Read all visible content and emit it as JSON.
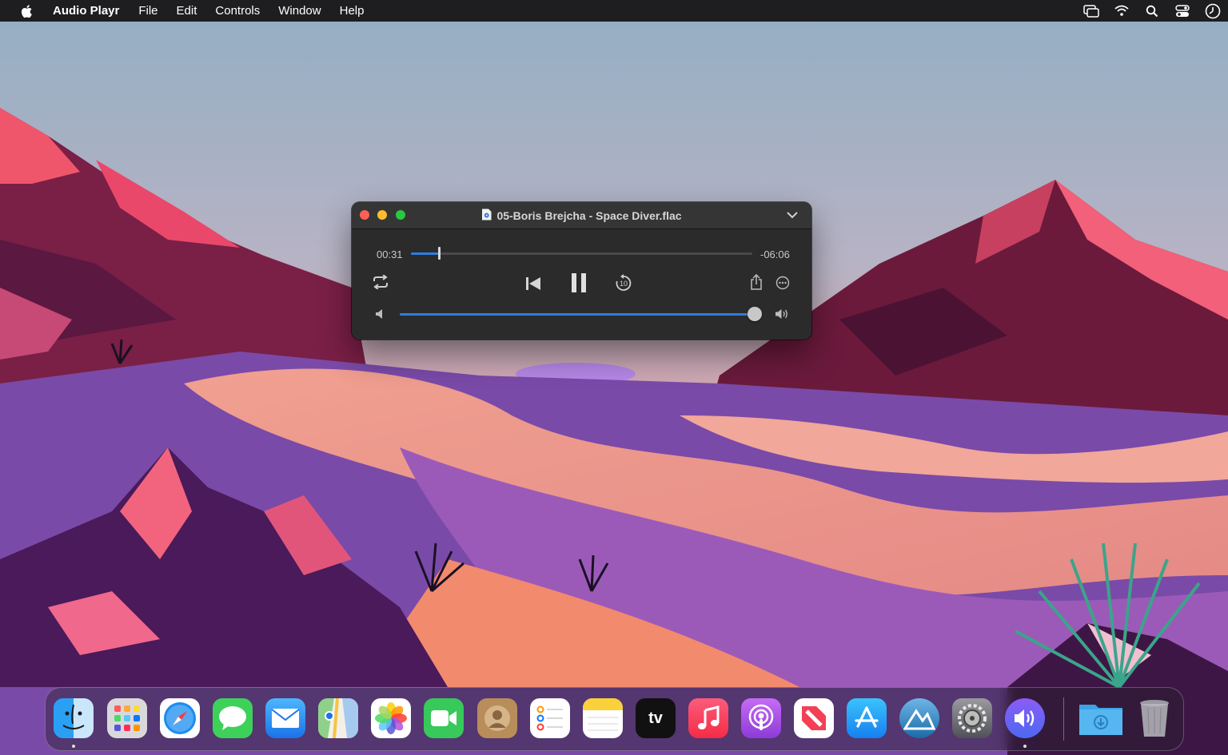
{
  "menubar": {
    "app_name": "Audio Playr",
    "menus": [
      "File",
      "Edit",
      "Controls",
      "Window",
      "Help"
    ],
    "status_icons": [
      "screen-mirroring-icon",
      "wifi-icon",
      "search-icon",
      "control-center-icon",
      "clock-icon"
    ]
  },
  "player": {
    "title": "05-Boris Brejcha - Space Diver.flac",
    "elapsed": "00:31",
    "remaining": "-06:06",
    "progress_fraction": 0.083,
    "volume_fraction": 0.995,
    "controls": [
      "repeat-icon",
      "previous-track-icon",
      "pause-icon",
      "skip-back-10-icon",
      "share-icon",
      "more-icon"
    ],
    "accent_color": "#2f7de1"
  },
  "dock": {
    "apps": [
      {
        "name": "Finder",
        "icon": "finder-icon",
        "running": true
      },
      {
        "name": "Launchpad",
        "icon": "launchpad-icon",
        "running": false
      },
      {
        "name": "Safari",
        "icon": "safari-icon",
        "running": false
      },
      {
        "name": "Messages",
        "icon": "messages-icon",
        "running": false
      },
      {
        "name": "Mail",
        "icon": "mail-icon",
        "running": false
      },
      {
        "name": "Maps",
        "icon": "maps-icon",
        "running": false
      },
      {
        "name": "Photos",
        "icon": "photos-icon",
        "running": false
      },
      {
        "name": "FaceTime",
        "icon": "facetime-icon",
        "running": false
      },
      {
        "name": "Contacts",
        "icon": "contacts-icon",
        "running": false
      },
      {
        "name": "Reminders",
        "icon": "reminders-icon",
        "running": false
      },
      {
        "name": "Notes",
        "icon": "notes-icon",
        "running": false
      },
      {
        "name": "TV",
        "icon": "apple-tv-icon",
        "label": "tv",
        "running": false
      },
      {
        "name": "Music",
        "icon": "music-icon",
        "running": false
      },
      {
        "name": "Podcasts",
        "icon": "podcasts-icon",
        "running": false
      },
      {
        "name": "News",
        "icon": "news-icon",
        "running": false
      },
      {
        "name": "App Store",
        "icon": "app-store-icon",
        "running": false
      },
      {
        "name": "Monterey",
        "icon": "monterey-icon",
        "running": false
      },
      {
        "name": "System Preferences",
        "icon": "system-preferences-icon",
        "running": false
      },
      {
        "name": "Audio Playr",
        "icon": "audio-playr-icon",
        "running": true
      },
      {
        "name": "Downloads",
        "icon": "downloads-folder-icon",
        "running": false
      },
      {
        "name": "Trash",
        "icon": "trash-icon",
        "running": false
      }
    ]
  }
}
